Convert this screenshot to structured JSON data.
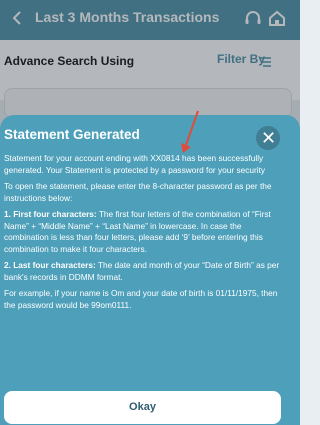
{
  "header": {
    "title": "Last 3 Months Transactions"
  },
  "search": {
    "advance_label": "Advance Search Using",
    "filter_label": "Filter By"
  },
  "modal": {
    "title": "Statement Generated",
    "p1": "Statement for your account ending with XX0814 has been successfully generated. Your Statement is protected by a password for your security",
    "p2": "To open the statement, please enter the 8-character password as per the instructions below:",
    "rule1_head": "1. First four characters:",
    "rule1_text": " The first four letters of the combination of “First Name” + “Middle Name” + “Last Name” in lowercase. In case the combination is less than four letters, please add ‘9’ before entering this combination to make it four characters.",
    "rule2_head": "2. Last four characters:",
    "rule2_text": " The date and month of your “Date of Birth” as per bank's records in DDMM format.",
    "example": "For example, if your name is Om and your date of birth is 01/11/1975, then the password would be 99om0111.",
    "ok_label": "Okay"
  },
  "colors": {
    "header_bg": "#4e93a7",
    "modal_bg": "#4d9fba",
    "annotation_arrow": "#e24b3b"
  }
}
